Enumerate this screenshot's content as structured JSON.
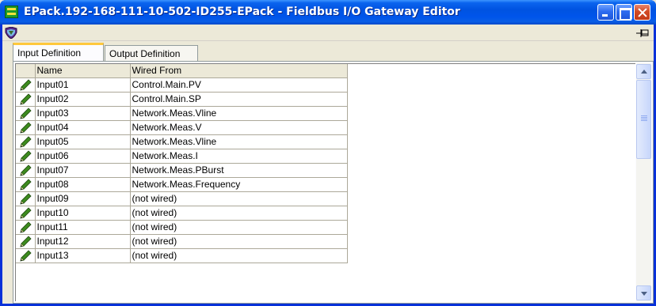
{
  "window": {
    "title": "EPack.192-168-111-10-502-ID255-EPack - Fieldbus I/O Gateway Editor",
    "icon": "app-green-icon"
  },
  "toolbar": {
    "tool_icon": "heart-shield-icon",
    "pin_icon": "pin-icon"
  },
  "tabs": [
    {
      "label": "Input Definition",
      "active": true
    },
    {
      "label": "Output Definition",
      "active": false
    }
  ],
  "grid": {
    "columns": [
      "Name",
      "Wired From"
    ],
    "rows": [
      {
        "name": "Input01",
        "wired": "Control.Main.PV"
      },
      {
        "name": "Input02",
        "wired": "Control.Main.SP"
      },
      {
        "name": "Input03",
        "wired": "Network.Meas.Vline"
      },
      {
        "name": "Input04",
        "wired": "Network.Meas.V"
      },
      {
        "name": "Input05",
        "wired": "Network.Meas.Vline"
      },
      {
        "name": "Input06",
        "wired": "Network.Meas.I"
      },
      {
        "name": "Input07",
        "wired": "Network.Meas.PBurst"
      },
      {
        "name": "Input08",
        "wired": "Network.Meas.Frequency"
      },
      {
        "name": "Input09",
        "wired": "(not wired)"
      },
      {
        "name": "Input10",
        "wired": "(not wired)"
      },
      {
        "name": "Input11",
        "wired": "(not wired)"
      },
      {
        "name": "Input12",
        "wired": "(not wired)"
      },
      {
        "name": "Input13",
        "wired": "(not wired)"
      }
    ]
  },
  "colors": {
    "title_bar": "#0055eb",
    "tab_highlight": "#ffc83c",
    "pencil": "#3d8b1e"
  }
}
